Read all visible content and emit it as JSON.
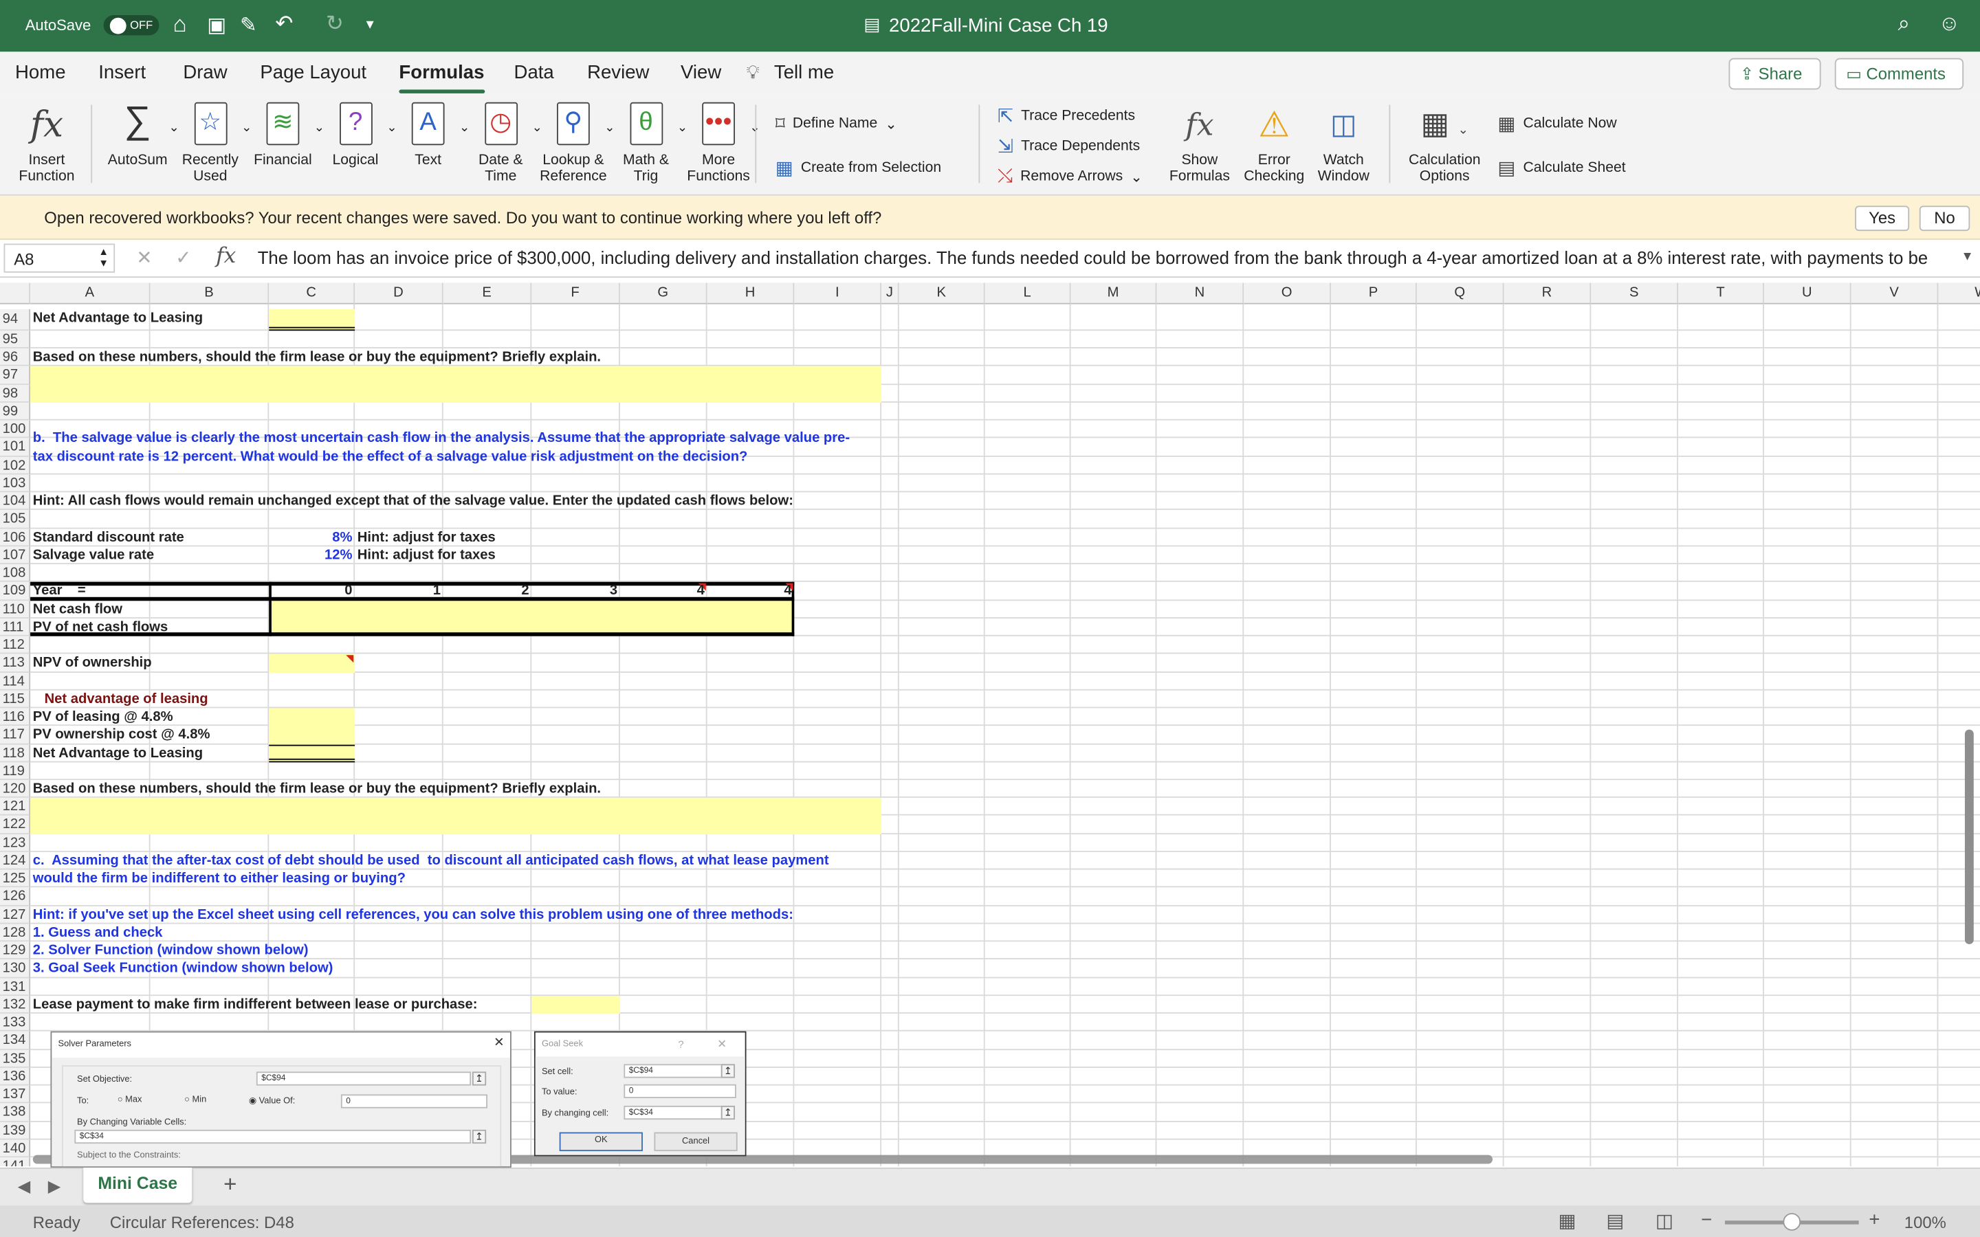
{
  "titlebar": {
    "autosave_label": "AutoSave",
    "autosave_state": "OFF",
    "doc_title": "2022Fall-Mini Case Ch 19"
  },
  "tabs": [
    "Home",
    "Insert",
    "Draw",
    "Page Layout",
    "Formulas",
    "Data",
    "Review",
    "View",
    "Tell me"
  ],
  "active_tab": "Formulas",
  "share_label": "Share",
  "comments_label": "Comments",
  "ribbon": {
    "insert_function": [
      "Insert",
      "Function"
    ],
    "groups": [
      {
        "l1": "AutoSum",
        "l2": "",
        "icon": "∑"
      },
      {
        "l1": "Recently",
        "l2": "Used",
        "icon": "☆"
      },
      {
        "l1": "Financial",
        "l2": "",
        "icon": "≋"
      },
      {
        "l1": "Logical",
        "l2": "",
        "icon": "?"
      },
      {
        "l1": "Text",
        "l2": "",
        "icon": "A"
      },
      {
        "l1": "Date &",
        "l2": "Time",
        "icon": "◷"
      },
      {
        "l1": "Lookup &",
        "l2": "Reference",
        "icon": "⚲"
      },
      {
        "l1": "Math &",
        "l2": "Trig",
        "icon": "θ"
      },
      {
        "l1": "More",
        "l2": "Functions",
        "icon": "•••"
      }
    ],
    "define_name": "Define Name",
    "create_from_selection": "Create from Selection",
    "trace_precedents": "Trace Precedents",
    "trace_dependents": "Trace Dependents",
    "remove_arrows": "Remove Arrows",
    "show_formulas": [
      "Show",
      "Formulas"
    ],
    "error_checking": [
      "Error",
      "Checking"
    ],
    "watch_window": [
      "Watch",
      "Window"
    ],
    "calculation_options": [
      "Calculation",
      "Options"
    ],
    "calculate_now": "Calculate Now",
    "calculate_sheet": "Calculate Sheet"
  },
  "notice": {
    "text": "Open recovered workbooks?  Your recent changes were saved. Do you want to continue working where you left off?",
    "yes": "Yes",
    "no": "No"
  },
  "formula_bar": {
    "name_box": "A8",
    "fx": "fx",
    "content": "The loom has an invoice price of $300,000, including delivery and installation charges.  The funds needed could be borrowed from the bank through a 4-year amortized loan at a 8% interest rate, with payments to be"
  },
  "columns": [
    "A",
    "B",
    "C",
    "D",
    "E",
    "F",
    "G",
    "H",
    "I",
    "J",
    "K",
    "L",
    "M",
    "N",
    "O",
    "P",
    "Q",
    "R",
    "S",
    "T",
    "U",
    "V",
    "W"
  ],
  "rows": [
    94,
    95,
    96,
    97,
    98,
    99,
    100,
    101,
    102,
    103,
    104,
    105,
    106,
    107,
    108,
    109,
    110,
    111,
    112,
    113,
    114,
    115,
    116,
    117,
    118,
    119,
    120,
    121,
    122,
    123,
    124,
    125,
    126,
    127,
    128,
    129,
    130,
    131,
    132,
    133,
    134,
    135,
    136,
    137,
    138,
    139,
    140,
    141
  ],
  "input_ranges": [
    "C94",
    "A97:I98",
    "C110:H111",
    "C113",
    "C116:C118",
    "A121:I122",
    "F132"
  ],
  "cells": [
    {
      "ref": "A94",
      "text": "Net Advantage to Leasing",
      "style": "bold"
    },
    {
      "ref": "A96",
      "text": "Based on these numbers, should the firm lease or buy the equipment? Briefly explain.",
      "style": "bold"
    },
    {
      "ref": "A100",
      "text": "b.  The salvage value is clearly the most uncertain cash flow in the analysis. Assume that the appropriate salvage value pre-",
      "style": "blue",
      "dy": 0.5
    },
    {
      "ref": "A101",
      "text": "tax discount rate is 12 percent. What would be the effect of a salvage value risk adjustment on the decision?",
      "style": "blue",
      "dy": 0.5
    },
    {
      "ref": "A104",
      "text": "Hint: All cash flows would remain unchanged except that of the salvage value. Enter the updated cash flows below:",
      "style": "bold"
    },
    {
      "ref": "A106",
      "text": "Standard discount rate",
      "style": "bold"
    },
    {
      "ref": "C106",
      "text": "8%",
      "style": "blue right"
    },
    {
      "ref": "D106",
      "text": "Hint: adjust for taxes",
      "style": "bold"
    },
    {
      "ref": "A107",
      "text": "Salvage value rate",
      "style": "bold"
    },
    {
      "ref": "C107",
      "text": "12%",
      "style": "blue right"
    },
    {
      "ref": "D107",
      "text": "Hint: adjust for taxes",
      "style": "bold"
    },
    {
      "ref": "A109",
      "text": "Year    =",
      "style": "bold"
    },
    {
      "ref": "C109",
      "text": "0",
      "style": "bold right"
    },
    {
      "ref": "D109",
      "text": "1",
      "style": "bold right"
    },
    {
      "ref": "E109",
      "text": "2",
      "style": "bold right"
    },
    {
      "ref": "F109",
      "text": "3",
      "style": "bold right"
    },
    {
      "ref": "G109",
      "text": "4",
      "style": "bold right"
    },
    {
      "ref": "H109",
      "text": "4",
      "style": "bold right"
    },
    {
      "ref": "A110",
      "text": "Net cash flow",
      "style": "bold"
    },
    {
      "ref": "A111",
      "text": "PV of net cash flows",
      "style": "bold"
    },
    {
      "ref": "A113",
      "text": "NPV of ownership",
      "style": "bold"
    },
    {
      "ref": "A115",
      "text": "   Net advantage of leasing",
      "style": "darkred"
    },
    {
      "ref": "A116",
      "text": "PV of leasing @ 4.8%",
      "style": "bold"
    },
    {
      "ref": "A117",
      "text": "PV ownership cost @ 4.8%",
      "style": "bold"
    },
    {
      "ref": "A118",
      "text": "Net Advantage to Leasing",
      "style": "bold"
    },
    {
      "ref": "A120",
      "text": "Based on these numbers, should the firm lease or buy the equipment? Briefly explain.",
      "style": "bold"
    },
    {
      "ref": "A124",
      "text": "c.  Assuming that the after-tax cost of debt should be used  to discount all anticipated cash flows, at what lease payment",
      "style": "blue"
    },
    {
      "ref": "A125",
      "text": "would the firm be indifferent to either leasing or buying?",
      "style": "blue"
    },
    {
      "ref": "A127",
      "text": "Hint: if you've set up the Excel sheet using cell references, you can solve this problem using one of three methods:",
      "style": "blue"
    },
    {
      "ref": "A128",
      "text": "1. Guess and check",
      "style": "blue"
    },
    {
      "ref": "A129",
      "text": "2. Solver Function (window shown below)",
      "style": "blue"
    },
    {
      "ref": "A130",
      "text": "3. Goal Seek Function (window shown below)",
      "style": "blue"
    },
    {
      "ref": "A132",
      "text": "Lease payment to make firm indifferent between lease or purchase:",
      "style": "bold"
    }
  ],
  "comment_markers": [
    "G109",
    "H109",
    "C113"
  ],
  "solver": {
    "title": "Solver Parameters",
    "set_objective_label": "Set Objective:",
    "set_objective": "$C$94",
    "to_label": "To:",
    "max": "Max",
    "min": "Min",
    "value_of": "Value Of:",
    "value": "0",
    "changing_label": "By Changing Variable Cells:",
    "changing": "$C$34",
    "constraints_label": "Subject to the Constraints:",
    "selected": "Value Of"
  },
  "goal_seek": {
    "title": "Goal Seek",
    "help": "?",
    "set_cell_label": "Set cell:",
    "set_cell": "$C$94",
    "to_value_label": "To value:",
    "to_value": "0",
    "changing_label": "By changing cell:",
    "changing": "$C$34",
    "ok": "OK",
    "cancel": "Cancel"
  },
  "sheet_tabs": [
    "Mini Case"
  ],
  "status": {
    "ready": "Ready",
    "circular": "Circular References: D48",
    "zoom": "100%",
    "zoom_fraction": 0.5
  },
  "colors": {
    "title_green": "#2f7449",
    "input_yellow": "#ffffa8",
    "question_blue": "#1f35e0",
    "heading_darkred": "#7a1212"
  }
}
